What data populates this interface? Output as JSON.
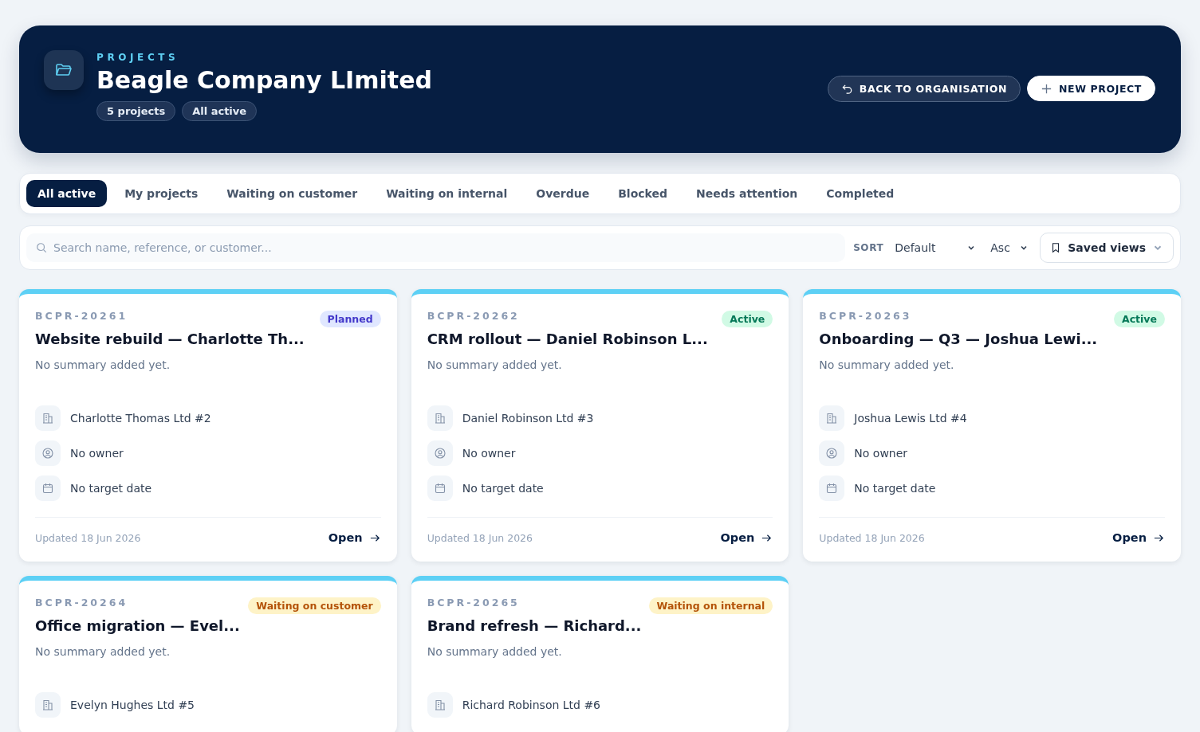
{
  "header": {
    "eyebrow": "PROJECTS",
    "title": "Beagle Company LImited",
    "chips": [
      "5 projects",
      "All active"
    ],
    "back_button": "BACK TO ORGANISATION",
    "new_button": "NEW PROJECT"
  },
  "tabs": [
    {
      "label": "All active",
      "selected": true
    },
    {
      "label": "My projects",
      "selected": false
    },
    {
      "label": "Waiting on customer",
      "selected": false
    },
    {
      "label": "Waiting on internal",
      "selected": false
    },
    {
      "label": "Overdue",
      "selected": false
    },
    {
      "label": "Blocked",
      "selected": false
    },
    {
      "label": "Needs attention",
      "selected": false
    },
    {
      "label": "Completed",
      "selected": false
    }
  ],
  "toolbar": {
    "search": {
      "placeholder": "Search name, reference, or customer..."
    },
    "sort_label": "SORT",
    "sort_value": "Default",
    "order_value": "Asc",
    "saved_views": "Saved views"
  },
  "cards": [
    {
      "reference": "BCPR-20261",
      "title": "Website rebuild — Charlotte Th...",
      "status": {
        "label": "Planned",
        "kind": "planned"
      },
      "summary": "No summary added yet.",
      "meta": [
        {
          "kind": "customer",
          "text": "Charlotte Thomas Ltd #2"
        },
        {
          "kind": "owner",
          "text": "No owner"
        },
        {
          "kind": "date",
          "text": "No target date"
        }
      ],
      "updated": "Updated 18 Jun 2026",
      "open": "Open"
    },
    {
      "reference": "BCPR-20262",
      "title": "CRM rollout — Daniel Robinson L...",
      "status": {
        "label": "Active",
        "kind": "active"
      },
      "summary": "No summary added yet.",
      "meta": [
        {
          "kind": "customer",
          "text": "Daniel Robinson Ltd #3"
        },
        {
          "kind": "owner",
          "text": "No owner"
        },
        {
          "kind": "date",
          "text": "No target date"
        }
      ],
      "updated": "Updated 18 Jun 2026",
      "open": "Open"
    },
    {
      "reference": "BCPR-20263",
      "title": "Onboarding — Q3 — Joshua Lewi...",
      "status": {
        "label": "Active",
        "kind": "active"
      },
      "summary": "No summary added yet.",
      "meta": [
        {
          "kind": "customer",
          "text": "Joshua Lewis Ltd #4"
        },
        {
          "kind": "owner",
          "text": "No owner"
        },
        {
          "kind": "date",
          "text": "No target date"
        }
      ],
      "updated": "Updated 18 Jun 2026",
      "open": "Open"
    },
    {
      "reference": "BCPR-20264",
      "title": "Office migration — Evel...",
      "status": {
        "label": "Waiting on customer",
        "kind": "waiting"
      },
      "summary": "No summary added yet.",
      "meta": [
        {
          "kind": "customer",
          "text": "Evelyn Hughes Ltd #5"
        }
      ]
    },
    {
      "reference": "BCPR-20265",
      "title": "Brand refresh — Richard...",
      "status": {
        "label": "Waiting on internal",
        "kind": "waiting"
      },
      "summary": "No summary added yet.",
      "meta": [
        {
          "kind": "customer",
          "text": "Richard Robinson Ltd #6"
        }
      ]
    }
  ]
}
